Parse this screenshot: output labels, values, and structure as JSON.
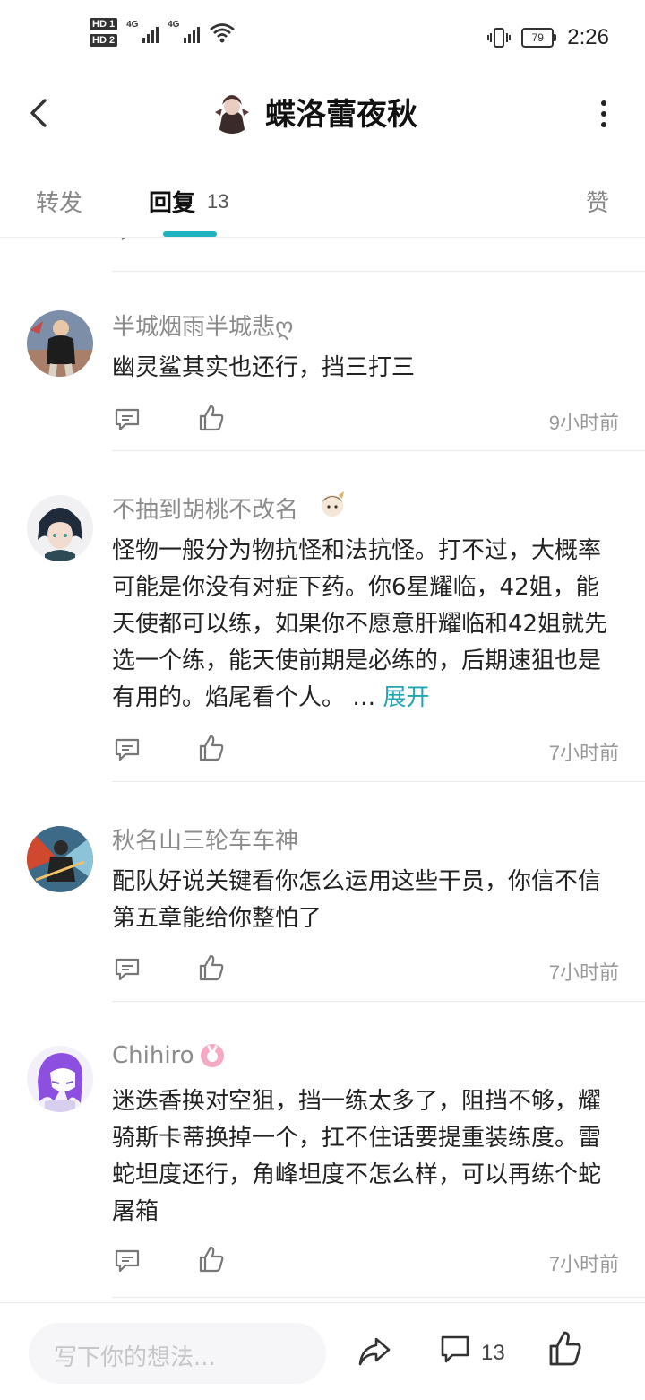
{
  "status_bar": {
    "sim1": "HD 1",
    "sim2": "HD 2",
    "net1": "4G",
    "net2": "4G",
    "battery": "79",
    "time": "2:26"
  },
  "header": {
    "title": "蝶洛蕾夜秋"
  },
  "tabs": {
    "forward": "转发",
    "reply": "回复",
    "reply_count": "13",
    "like": "赞"
  },
  "comments": [
    {
      "username": "半城烟雨半城悲ღ",
      "text": "幽灵鲨其实也还行，挡三打三",
      "time": "9小时前"
    },
    {
      "username": "不抽到胡桃不改名",
      "text": "怪物一般分为物抗怪和法抗怪。打不过，大概率可能是你没有对症下药。你6星耀临，42姐，能天使都可以练，如果你不愿意肝耀临和42姐就先选一个练，能天使前期是必练的，后期速狙也是有用的。焰尾看个人。 …",
      "expand": "展开",
      "time": "7小时前"
    },
    {
      "username": "秋名山三轮车车神",
      "text": "配队好说关键看你怎么运用这些干员，你信不信第五章能给你整怕了",
      "time": "7小时前"
    },
    {
      "username": "Chihiro",
      "text": "迷迭香换对空狙，挡一练太多了，阻挡不够，耀骑斯卡蒂换掉一个，扛不住话要提重装练度。雷蛇坦度还行，角峰坦度不怎么样，可以再练个蛇屠箱",
      "time": "7小时前"
    }
  ],
  "bottom_bar": {
    "input_placeholder": "写下你的想法...",
    "comment_count": "13"
  },
  "colors": {
    "accent": "#1fb3c1",
    "expand": "#1fa5b4"
  },
  "icons": [
    "back-icon",
    "more-icon",
    "reply-icon",
    "like-icon",
    "share-icon",
    "comment-icon",
    "wifi-icon",
    "vibrate-icon",
    "battery-icon"
  ]
}
